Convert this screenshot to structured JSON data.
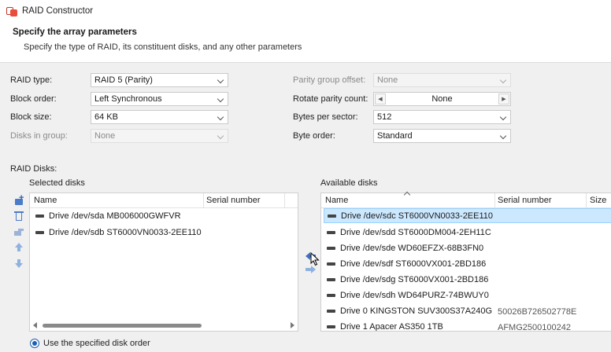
{
  "window": {
    "title": "RAID Constructor"
  },
  "header": {
    "title": "Specify the array parameters",
    "subtitle": "Specify the type of RAID, its constituent disks, and any other parameters"
  },
  "params": {
    "raid_type": {
      "label": "RAID type:",
      "value": "RAID 5 (Parity)"
    },
    "block_order": {
      "label": "Block order:",
      "value": "Left Synchronous"
    },
    "block_size": {
      "label": "Block size:",
      "value": "64 KB"
    },
    "disks_in_group": {
      "label": "Disks in group:",
      "value": "None"
    },
    "parity_group_offset": {
      "label": "Parity group offset:",
      "value": "None"
    },
    "rotate_parity_count": {
      "label": "Rotate parity count:",
      "value": "None"
    },
    "bytes_per_sector": {
      "label": "Bytes per sector:",
      "value": "512"
    },
    "byte_order": {
      "label": "Byte order:",
      "value": "Standard"
    }
  },
  "raid_disks": {
    "label": "RAID Disks:",
    "selected": {
      "label": "Selected disks",
      "columns": {
        "name": "Name",
        "serial": "Serial number"
      },
      "rows": [
        {
          "name": "Drive /dev/sda MB006000GWFVR",
          "serial": ""
        },
        {
          "name": "Drive /dev/sdb ST6000VN0033-2EE110",
          "serial": ""
        }
      ]
    },
    "available": {
      "label": "Available disks",
      "columns": {
        "name": "Name",
        "serial": "Serial number",
        "size": "Size"
      },
      "rows": [
        {
          "name": "Drive /dev/sdc ST6000VN0033-2EE110",
          "serial": ""
        },
        {
          "name": "Drive /dev/sdd ST6000DM004-2EH11C",
          "serial": ""
        },
        {
          "name": "Drive /dev/sde WD60EFZX-68B3FN0",
          "serial": ""
        },
        {
          "name": "Drive /dev/sdf ST6000VX001-2BD186",
          "serial": ""
        },
        {
          "name": "Drive /dev/sdg ST6000VX001-2BD186",
          "serial": ""
        },
        {
          "name": "Drive /dev/sdh WD64PURZ-74BWUY0",
          "serial": ""
        },
        {
          "name": "Drive 0 KINGSTON SUV300S37A240G",
          "serial": "50026B726502778E"
        },
        {
          "name": "Drive 1 Apacer AS350 1TB",
          "serial": "AFMG2500100242"
        }
      ]
    }
  },
  "options": {
    "use_specified_order": "Use the specified disk order"
  }
}
